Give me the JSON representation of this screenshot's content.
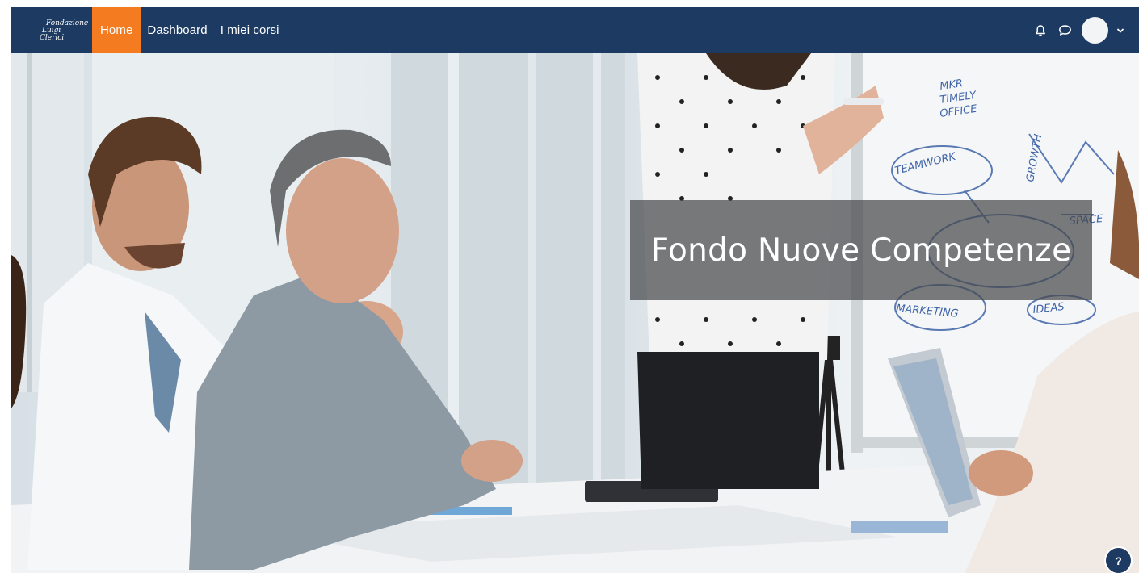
{
  "brand": {
    "logo_line1": "Fondazione",
    "logo_line2": "Luigi",
    "logo_line3": "Clerici"
  },
  "nav": {
    "items": [
      {
        "label": "Home",
        "active": true
      },
      {
        "label": "Dashboard",
        "active": false
      },
      {
        "label": "I miei corsi",
        "active": false
      }
    ],
    "right_icons": [
      "bell-icon",
      "chat-icon",
      "avatar",
      "chevron-down-icon"
    ]
  },
  "hero": {
    "title": "Fondo Nuove Competenze"
  },
  "whiteboard": {
    "words": [
      "MKR",
      "TIMELY",
      "OFFICE",
      "TEAMWORK",
      "GROWTH",
      "MARKETING",
      "IDEAS",
      "SPACE"
    ]
  },
  "help": {
    "label": "?"
  },
  "colors": {
    "navbar": "#1d3a63",
    "active_tab": "#f47b20",
    "banner": "#46484b"
  }
}
